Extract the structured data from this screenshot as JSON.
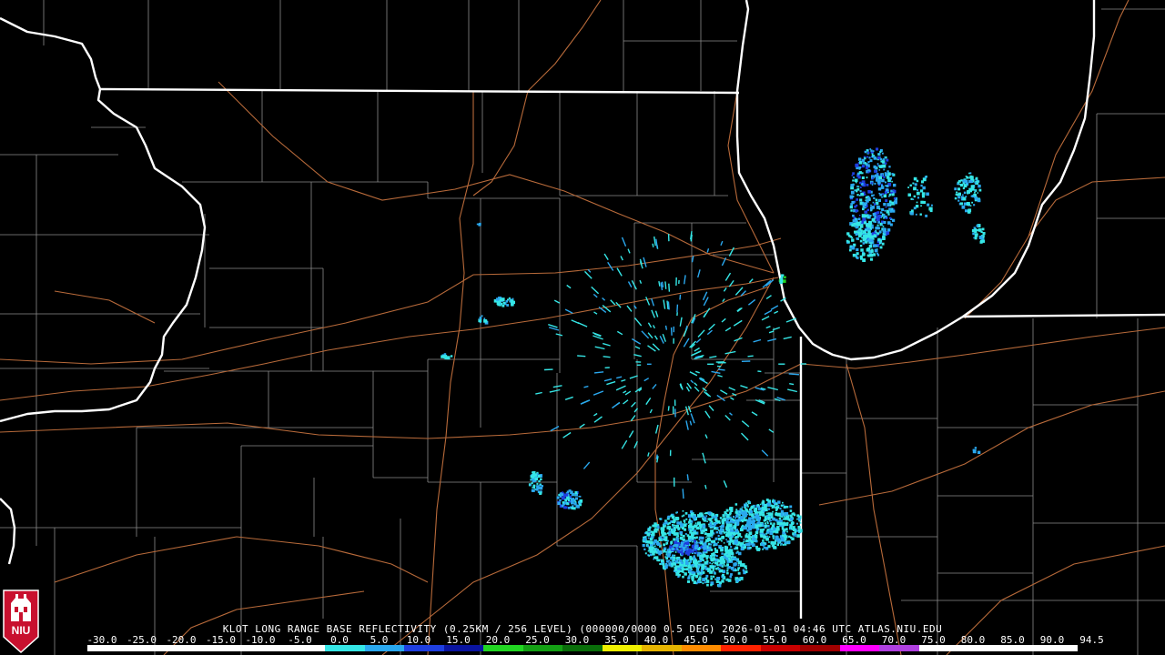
{
  "product_caption": "KLOT LONG RANGE BASE REFLECTIVITY (0.25KM / 256 LEVEL) (000000/0000 0.5 DEG) 2026-01-01 04:46 UTC  ATLAS.NIU.EDU",
  "logo_text": "NIU",
  "colors": {
    "background": "#000000",
    "state_border": "#ffffff",
    "county_line": "#8a8a8a",
    "highway": "#b86a3a",
    "echo_light": "#35e6e6",
    "echo_mid": "#2aa8ef",
    "echo_heavy": "#1f3fe0",
    "logo_red": "#c8102e"
  },
  "scale": {
    "labels": [
      "-30.0",
      "-25.0",
      "-20.0",
      "-15.0",
      "-10.0",
      "-5.0",
      "0.0",
      "5.0",
      "10.0",
      "15.0",
      "20.0",
      "25.0",
      "30.0",
      "35.0",
      "40.0",
      "45.0",
      "50.0",
      "55.0",
      "60.0",
      "65.0",
      "70.0",
      "75.0",
      "80.0",
      "85.0",
      "90.0",
      "94.5"
    ],
    "colors": [
      "#ffffff",
      "#ffffff",
      "#ffffff",
      "#ffffff",
      "#ffffff",
      "#ffffff",
      "#35e6e6",
      "#2aa8ef",
      "#1f3fe0",
      "#0a14a0",
      "#22d622",
      "#14a014",
      "#0a6e0a",
      "#f0f000",
      "#e6b400",
      "#ff8c00",
      "#ff2200",
      "#c80000",
      "#a00000",
      "#ff00ff",
      "#b040e0",
      "#ffffff",
      "#ffffff",
      "#ffffff",
      "#ffffff"
    ]
  }
}
